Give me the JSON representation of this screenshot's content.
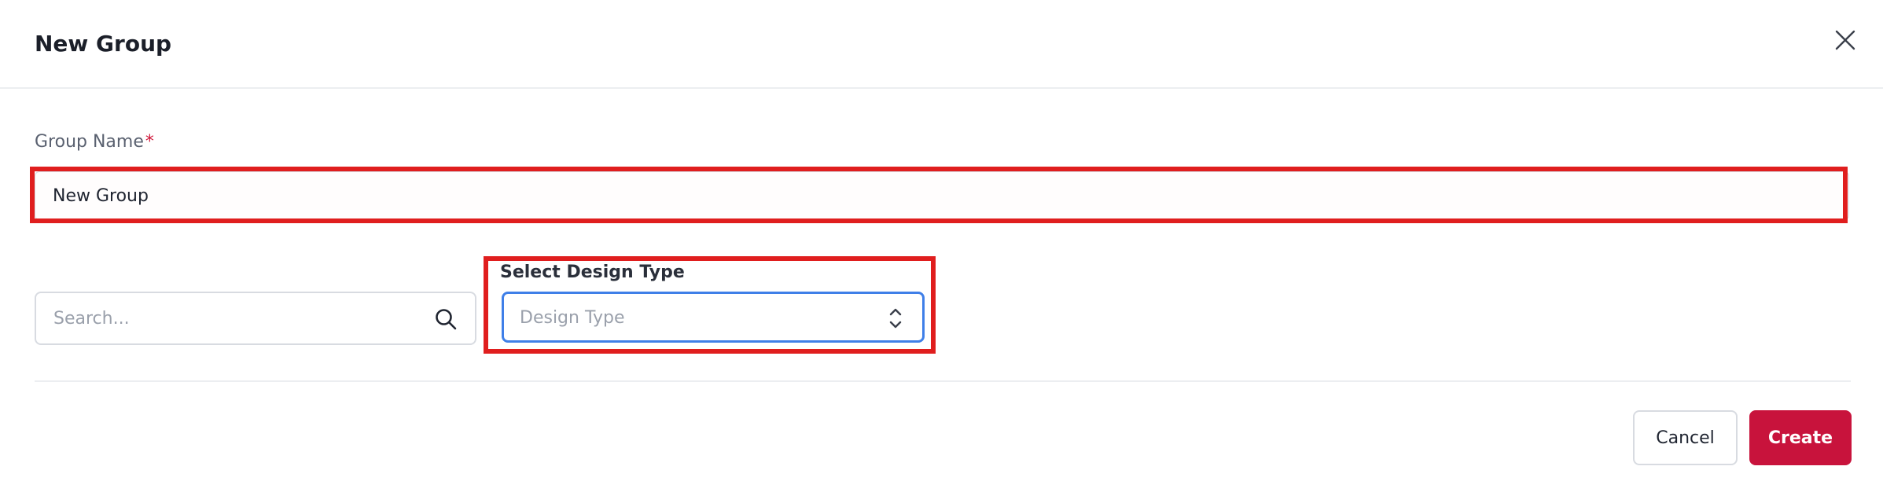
{
  "dialog": {
    "title": "New Group",
    "close_icon": "close-icon"
  },
  "group_name": {
    "label": "Group Name",
    "required_marker": "*",
    "value": "New Group"
  },
  "search": {
    "placeholder": "Search...",
    "icon": "search-icon"
  },
  "design_type": {
    "label": "Select Design Type",
    "placeholder": "Design Type",
    "icon": "chevron-up-down-icon"
  },
  "footer": {
    "cancel_label": "Cancel",
    "create_label": "Create"
  },
  "colors": {
    "primary": "#c8133c",
    "focus_border": "#3f7fe8",
    "annotation": "#e01e1e",
    "required": "#d11a3c"
  }
}
